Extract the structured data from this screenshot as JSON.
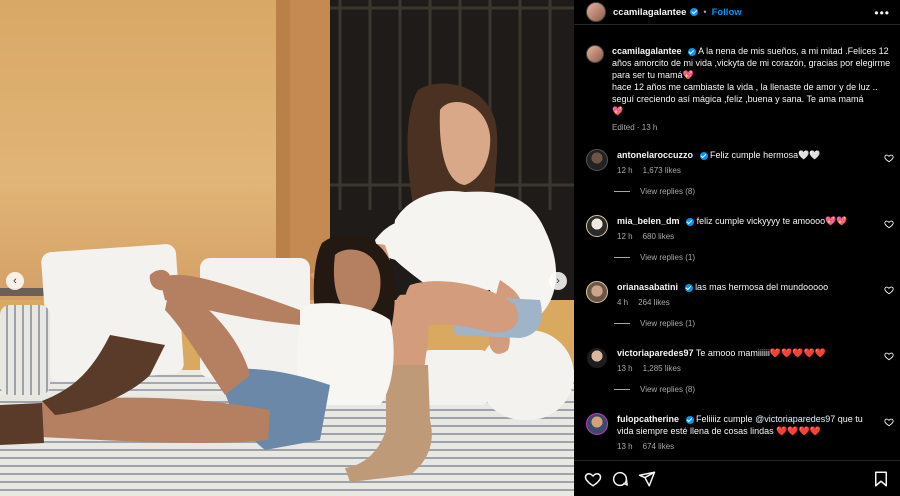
{
  "header": {
    "username": "ccamilagalantee",
    "follow_label": "Follow",
    "more_label": "•••"
  },
  "caption": {
    "username": "ccamilagalantee",
    "text": "A la nena de mis sueños, a mi mitad .Felices 12 años amorcito de mi vida ,vickyta de mi corazón, gracias por elegirme para ser tu mamá",
    "text2": "hace 12 años me cambiaste la vida , la llenaste de amor y de luz .. seguí creciendo así mágica ,feliz ,buena y sana. Te ama mamá",
    "edited": "Edited",
    "time": "13 h"
  },
  "comments": [
    {
      "username": "antonelaroccuzzo",
      "verified": true,
      "text": "Feliz cumple hermosa",
      "emoji": "🤍🤍",
      "time": "12 h",
      "likes": "1,673 likes",
      "replies": "View replies (8)"
    },
    {
      "username": "mia_belen_dm",
      "verified": true,
      "text": "feliz cumple vickyyyy te amoooo",
      "emoji": "💖💖",
      "time": "12 h",
      "likes": "680 likes",
      "replies": "View replies (1)"
    },
    {
      "username": "orianasabatini",
      "verified": true,
      "text": "las mas hermosa del mundooooo",
      "emoji": "",
      "time": "4 h",
      "likes": "264 likes",
      "replies": "View replies (1)"
    },
    {
      "username": "victoriaparedes97",
      "verified": false,
      "text": "Te amooo mamiiiiii",
      "emoji": "❤️❤️❤️❤️❤️",
      "time": "13 h",
      "likes": "1,285 likes",
      "replies": "View replies (8)"
    },
    {
      "username": "fulopcatherine",
      "verified": true,
      "text_before": "Feliiiiz cumple",
      "mention": "@victoriaparedes97",
      "text_after": "que tu vida siempre esté llena de cosas lindas",
      "emoji": "❤️❤️❤️❤️",
      "time": "13 h",
      "likes": "674 likes"
    }
  ],
  "actions": {
    "like_icon": "heart-outline-icon",
    "comment_icon": "comment-icon",
    "share_icon": "paper-plane-icon",
    "save_icon": "bookmark-icon"
  },
  "colors": {
    "accent": "#0095f6",
    "background": "#000000",
    "secondary_text": "#a8a8a8"
  }
}
